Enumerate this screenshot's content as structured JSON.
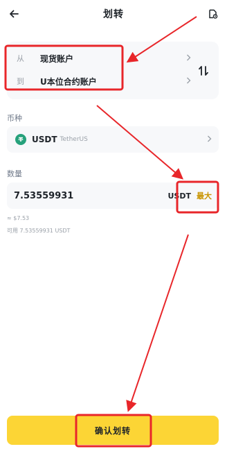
{
  "header": {
    "title": "划转",
    "back_icon": "arrow-left-icon",
    "history_icon": "transfer-history-icon"
  },
  "accounts": {
    "from_label": "从",
    "from_value": "现货账户",
    "to_label": "到",
    "to_value": "U本位合约账户",
    "swap_icon": "swap-vertical-icon"
  },
  "coin": {
    "section_label": "币种",
    "symbol": "USDT",
    "name": "TetherUS",
    "icon": "tether-icon",
    "icon_color": "#26a17b"
  },
  "amount": {
    "section_label": "数量",
    "value": "7.53559931",
    "unit": "USDT",
    "max_label": "最大",
    "usd_value": "≈ $7.53",
    "available_label": "可用",
    "available_value": "7.53559931 USDT"
  },
  "confirm": {
    "label": "确认划转",
    "color": "#fcd535"
  },
  "annotations": {
    "color": "#e8262a"
  }
}
